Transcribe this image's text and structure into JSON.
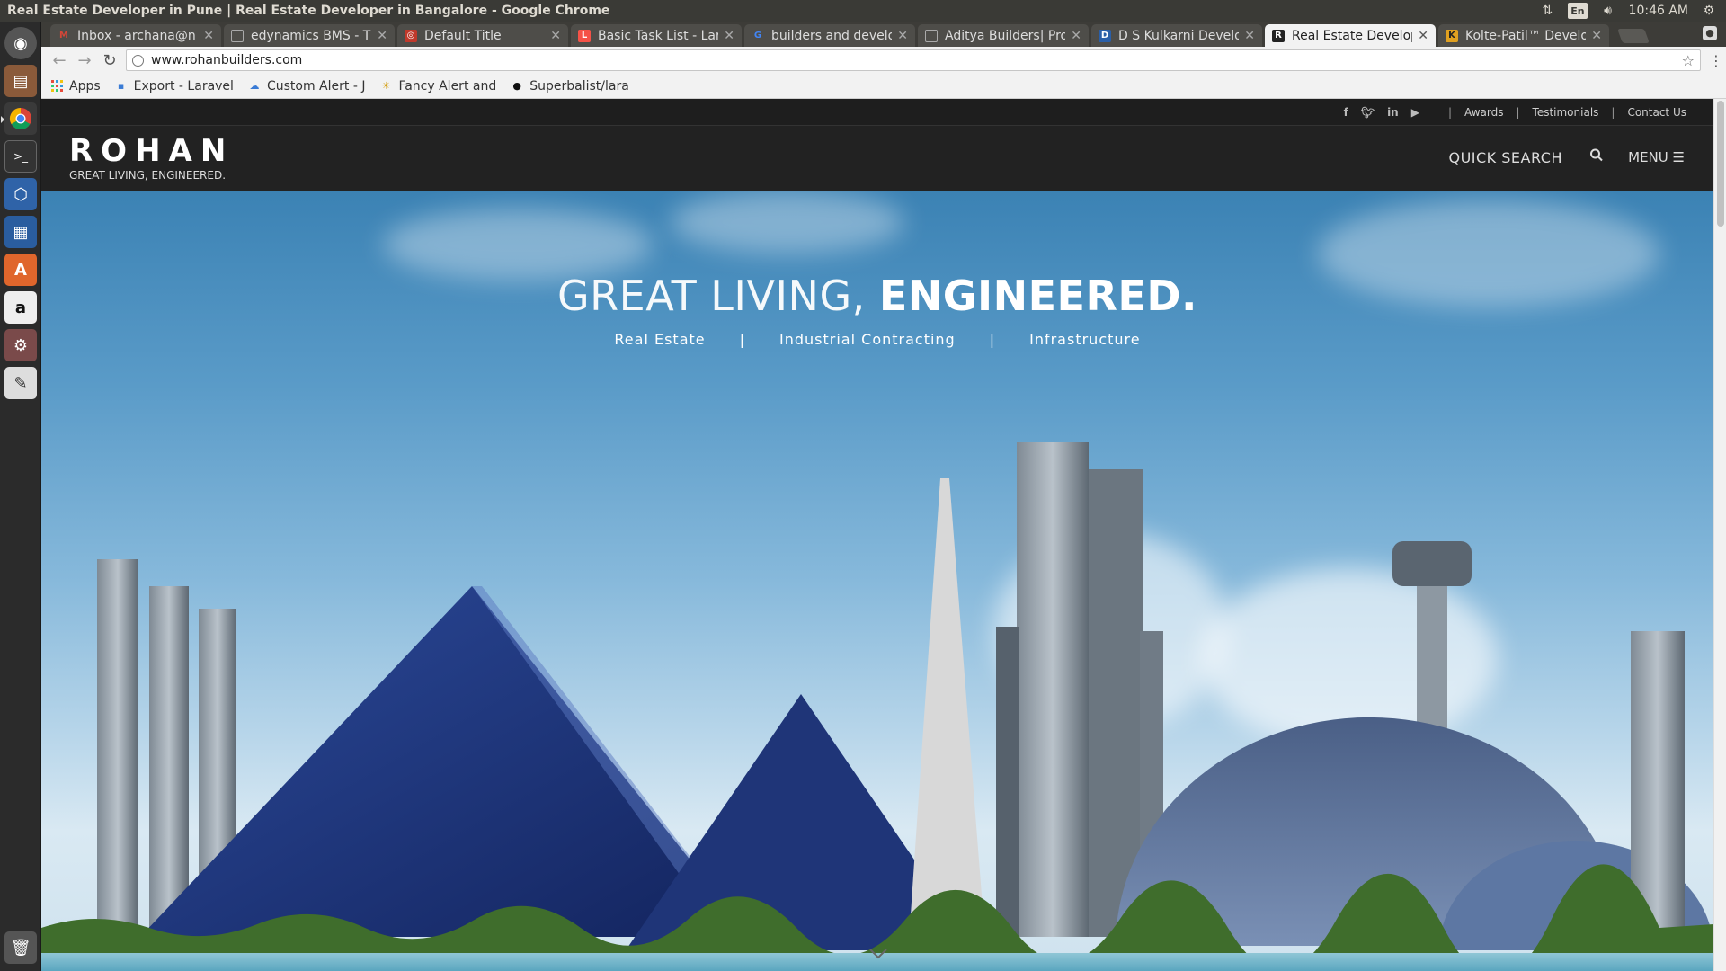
{
  "os": {
    "window_title": "Real Estate Developer in Pune | Real Estate Developer in Bangalore - Google Chrome",
    "language": "En",
    "clock": "10:46 AM"
  },
  "launcher": {
    "items": [
      "dash-home",
      "files",
      "chrome",
      "terminal",
      "virtualbox",
      "libreoffice-writer",
      "software-center",
      "amazon",
      "system-settings",
      "text-editor",
      "trash"
    ]
  },
  "browser": {
    "tabs": [
      {
        "title": "Inbox - archana@n",
        "favicon": "gmail-icon",
        "color": "#d44638"
      },
      {
        "title": "edynamics BMS - Th",
        "favicon": "page-icon",
        "color": "#888888"
      },
      {
        "title": "Default Title",
        "favicon": "red-square-icon",
        "color": "#c0392b"
      },
      {
        "title": "Basic Task List - Lar",
        "favicon": "laravel-icon",
        "color": "#f55247"
      },
      {
        "title": "builders and develo",
        "favicon": "google-icon",
        "color": "#4285f4"
      },
      {
        "title": "Aditya Builders| Pro",
        "favicon": "page-icon",
        "color": "#888888"
      },
      {
        "title": "D S Kulkarni Develo",
        "favicon": "dsk-icon",
        "color": "#2a5fa8"
      },
      {
        "title": "Real Estate Develop",
        "favicon": "rohan-icon",
        "color": "#222222"
      },
      {
        "title": "Kolte-Patil™ Develo",
        "favicon": "kolte-icon",
        "color": "#e0a020"
      }
    ],
    "url": "www.rohanbuilders.com",
    "bookmarks": [
      "Apps",
      "Export - Laravel",
      "Custom Alert - J",
      "Fancy Alert and",
      "Superbalist/lara"
    ]
  },
  "site": {
    "top_links": [
      "Awards",
      "Testimonials",
      "Contact Us"
    ],
    "social": [
      "f",
      "t",
      "in",
      "yt"
    ],
    "logo": {
      "word": "ROHAN",
      "tagline": "GREAT LIVING, ENGINEERED."
    },
    "quick_search": "QUICK SEARCH",
    "menu": "MENU",
    "hero": {
      "title_light": "GREAT LIVING, ",
      "title_bold": "ENGINEERED.",
      "divisions": [
        "Real Estate",
        "Industrial Contracting",
        "Infrastructure"
      ]
    }
  }
}
